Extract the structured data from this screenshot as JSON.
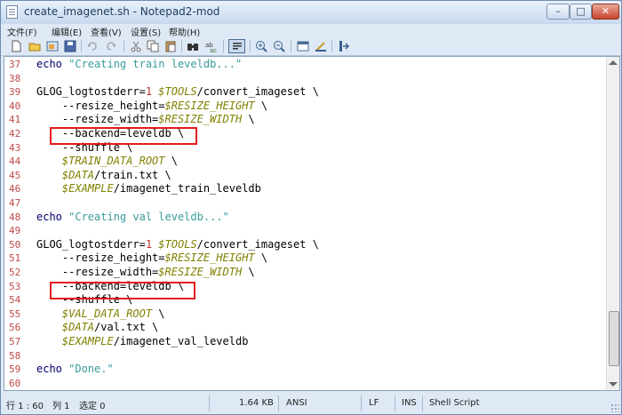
{
  "window": {
    "title": "create_imagenet.sh - Notepad2-mod"
  },
  "menu": [
    "文件(F)",
    "编辑(E)",
    "查看(V)",
    "设置(S)",
    "帮助(H)"
  ],
  "lines": [
    {
      "n": "37",
      "t": [
        [
          "kw",
          "echo "
        ],
        [
          "str",
          "\"Creating train leveldb...\""
        ]
      ]
    },
    {
      "n": "38",
      "t": []
    },
    {
      "n": "39",
      "t": [
        [
          "p",
          "GLOG_logtostderr="
        ],
        [
          "num",
          "1"
        ],
        [
          "p",
          " "
        ],
        [
          "var",
          "$TOOLS"
        ],
        [
          "p",
          "/convert_imageset \\"
        ]
      ]
    },
    {
      "n": "40",
      "t": [
        [
          "p",
          "    --resize_height="
        ],
        [
          "var",
          "$RESIZE_HEIGHT"
        ],
        [
          "p",
          " \\"
        ]
      ]
    },
    {
      "n": "41",
      "t": [
        [
          "p",
          "    --resize_width="
        ],
        [
          "var",
          "$RESIZE_WIDTH"
        ],
        [
          "p",
          " \\"
        ]
      ]
    },
    {
      "n": "42",
      "t": [
        [
          "p",
          "    --backend=leveldb \\"
        ]
      ]
    },
    {
      "n": "43",
      "t": [
        [
          "p",
          "    --shuffle \\"
        ]
      ]
    },
    {
      "n": "44",
      "t": [
        [
          "p",
          "    "
        ],
        [
          "var",
          "$TRAIN_DATA_ROOT"
        ],
        [
          "p",
          " \\"
        ]
      ]
    },
    {
      "n": "45",
      "t": [
        [
          "p",
          "    "
        ],
        [
          "var",
          "$DATA"
        ],
        [
          "p",
          "/train.txt \\"
        ]
      ]
    },
    {
      "n": "46",
      "t": [
        [
          "p",
          "    "
        ],
        [
          "var",
          "$EXAMPLE"
        ],
        [
          "p",
          "/imagenet_train_leveldb"
        ]
      ]
    },
    {
      "n": "47",
      "t": []
    },
    {
      "n": "48",
      "t": [
        [
          "kw",
          "echo "
        ],
        [
          "str",
          "\"Creating val leveldb...\""
        ]
      ]
    },
    {
      "n": "49",
      "t": []
    },
    {
      "n": "50",
      "t": [
        [
          "p",
          "GLOG_logtostderr="
        ],
        [
          "num",
          "1"
        ],
        [
          "p",
          " "
        ],
        [
          "var",
          "$TOOLS"
        ],
        [
          "p",
          "/convert_imageset \\"
        ]
      ]
    },
    {
      "n": "51",
      "t": [
        [
          "p",
          "    --resize_height="
        ],
        [
          "var",
          "$RESIZE_HEIGHT"
        ],
        [
          "p",
          " \\"
        ]
      ]
    },
    {
      "n": "52",
      "t": [
        [
          "p",
          "    --resize_width="
        ],
        [
          "var",
          "$RESIZE_WIDTH"
        ],
        [
          "p",
          " \\"
        ]
      ]
    },
    {
      "n": "53",
      "t": [
        [
          "p",
          "    --backend=leveldb \\"
        ]
      ]
    },
    {
      "n": "54",
      "t": [
        [
          "p",
          "    --shuffle \\"
        ]
      ]
    },
    {
      "n": "55",
      "t": [
        [
          "p",
          "    "
        ],
        [
          "var",
          "$VAL_DATA_ROOT"
        ],
        [
          "p",
          " \\"
        ]
      ]
    },
    {
      "n": "56",
      "t": [
        [
          "p",
          "    "
        ],
        [
          "var",
          "$DATA"
        ],
        [
          "p",
          "/val.txt \\"
        ]
      ]
    },
    {
      "n": "57",
      "t": [
        [
          "p",
          "    "
        ],
        [
          "var",
          "$EXAMPLE"
        ],
        [
          "p",
          "/imagenet_val_leveldb"
        ]
      ]
    },
    {
      "n": "58",
      "t": []
    },
    {
      "n": "59",
      "t": [
        [
          "kw",
          "echo "
        ],
        [
          "str",
          "\"Done.\""
        ]
      ]
    },
    {
      "n": "60",
      "t": []
    }
  ],
  "status": {
    "position": "行 1 : 60",
    "column": "列 1",
    "selection": "选定 0",
    "size": "1.64 KB",
    "encoding": "ANSI",
    "line_ending": "LF",
    "insert_mode": "INS",
    "language": "Shell Script"
  },
  "toolbar_icons": [
    "new-icon",
    "open-icon",
    "browse-icon",
    "save-icon",
    "undo-icon",
    "redo-icon",
    "cut-icon",
    "copy-icon",
    "paste-icon",
    "find-icon",
    "replace-icon",
    "word-wrap-icon",
    "zoom-in-icon",
    "zoom-out-icon",
    "scheme-icon",
    "customize-icon",
    "always-on-top-icon"
  ],
  "colors": {
    "line_number": "#c04a4a",
    "variable": "#808000",
    "string": "#3a9a9a",
    "number": "#c03030",
    "highlight_box": "#e41b1b"
  }
}
